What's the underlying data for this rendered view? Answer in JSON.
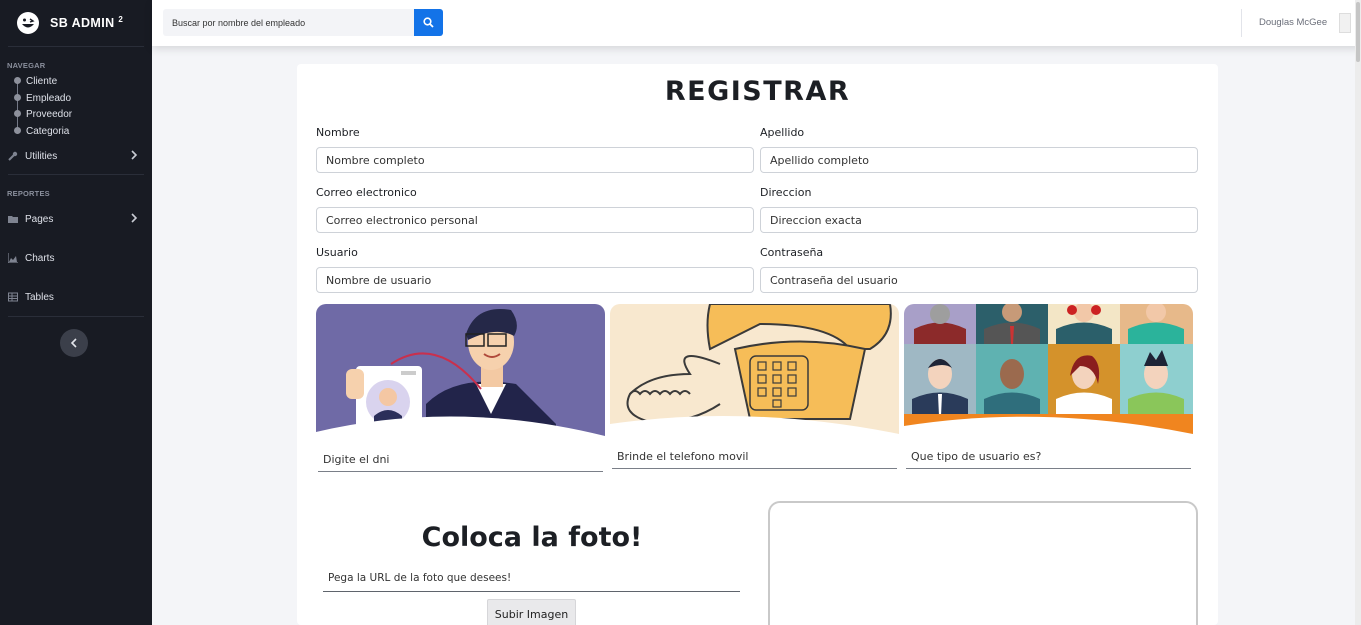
{
  "brand": {
    "name": "SB ADMIN",
    "sup": "2"
  },
  "sidebar": {
    "heading_navegar": "NAVEGAR",
    "subitems": [
      "Cliente",
      "Empleado",
      "Proveedor",
      "Categoria"
    ],
    "utilities": "Utilities",
    "heading_reportes": "REPORTES",
    "pages": "Pages",
    "charts": "Charts",
    "tables": "Tables"
  },
  "topbar": {
    "search_placeholder": "Buscar por nombre del empleado",
    "user_name": "Douglas McGee"
  },
  "form": {
    "title": "REGISTRAR",
    "nombre_label": "Nombre",
    "nombre_placeholder": "Nombre completo",
    "apellido_label": "Apellido",
    "apellido_placeholder": "Apellido completo",
    "correo_label": "Correo electronico",
    "correo_placeholder": "Correo electronico personal",
    "direccion_label": "Direccion",
    "direccion_placeholder": "Direccion exacta",
    "usuario_label": "Usuario",
    "usuario_placeholder": "Nombre de usuario",
    "contrasena_label": "Contraseña",
    "contrasena_placeholder": "Contraseña del usuario",
    "dni_placeholder": "Digite el dni",
    "telefono_placeholder": "Brinde el telefono movil",
    "tipo_placeholder": "Que tipo de usuario es?"
  },
  "photo": {
    "title": "Coloca la foto!",
    "url_placeholder": "Pega la URL de la foto que desees!",
    "upload_label": "Subir Imagen"
  },
  "colors": {
    "sidebar": "#181b23",
    "primary": "#1373e8"
  }
}
